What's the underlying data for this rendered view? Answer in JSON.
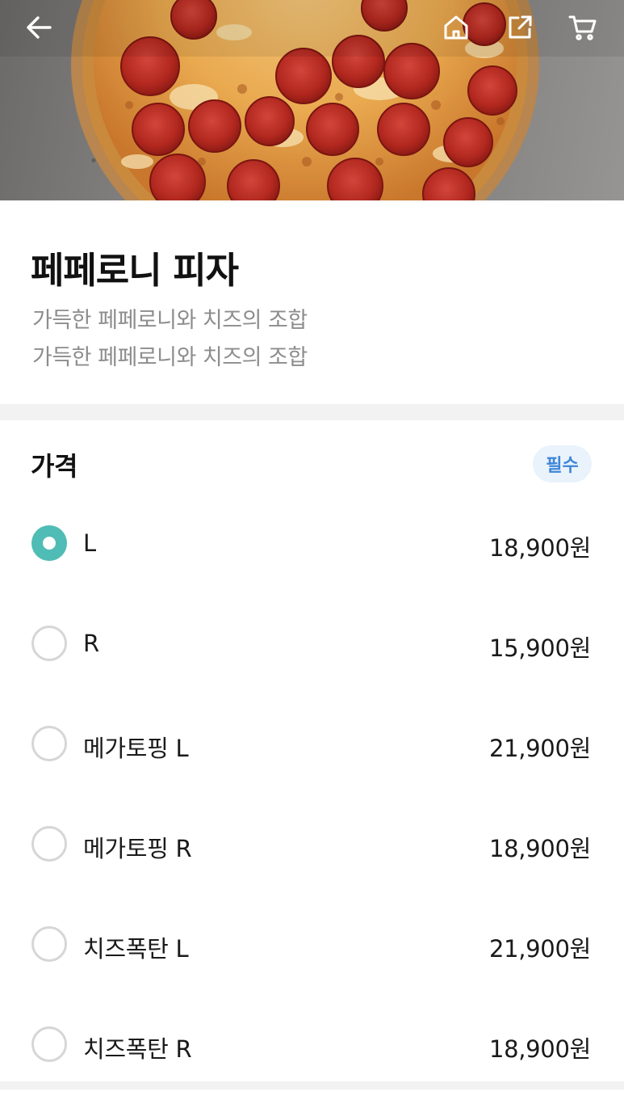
{
  "product": {
    "title": "페페로니 피자",
    "description": [
      "가득한 페페로니와 치즈의 조합",
      "가득한 페페로니와 치즈의 조합"
    ]
  },
  "icons": {
    "back": "back-arrow-icon",
    "home": "home-icon",
    "share": "share-icon",
    "cart": "cart-icon"
  },
  "price_section": {
    "title": "가격",
    "badge": "필수",
    "options": [
      {
        "label": "L",
        "price": "18,900원",
        "selected": true
      },
      {
        "label": "R",
        "price": "15,900원",
        "selected": false
      },
      {
        "label": "메가토핑 L",
        "price": "21,900원",
        "selected": false
      },
      {
        "label": "메가토핑 R",
        "price": "18,900원",
        "selected": false
      },
      {
        "label": "치즈폭탄 L",
        "price": "21,900원",
        "selected": false
      },
      {
        "label": "치즈폭탄 R",
        "price": "18,900원",
        "selected": false
      }
    ]
  },
  "colors": {
    "accent_teal": "#4fbcb5",
    "badge_bg": "#eaf3fc",
    "badge_text": "#3f86d8",
    "muted_text": "#8d8d8d"
  }
}
